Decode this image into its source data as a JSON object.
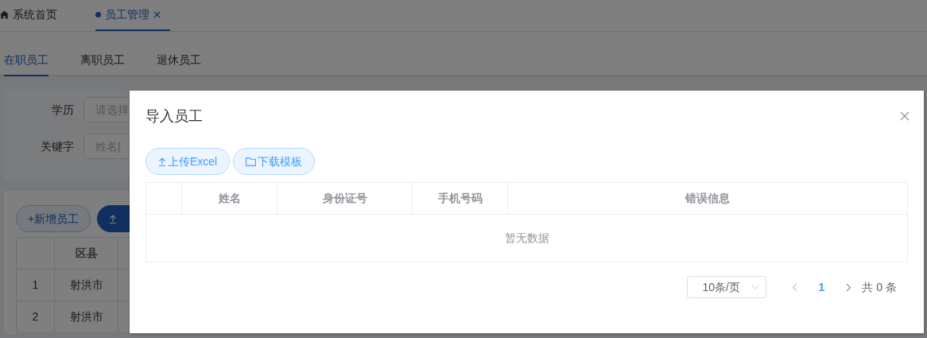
{
  "top_tabs": [
    {
      "kind": "home",
      "label": "系统首页",
      "selected": false
    },
    {
      "kind": "page",
      "label": "员工管理",
      "selected": true
    }
  ],
  "sub_tabs": [
    {
      "label": "在职员工",
      "selected": true
    },
    {
      "label": "离职员工",
      "selected": false
    },
    {
      "label": "退休员工",
      "selected": false
    }
  ],
  "filters": [
    {
      "label": "学历",
      "placeholder": "请选择"
    },
    {
      "label": "关键字",
      "placeholder": "姓名|"
    }
  ],
  "actions": [
    {
      "kind": "outline",
      "label": "+新增员工"
    },
    {
      "kind": "primary"
    }
  ],
  "table": {
    "columns": [
      "区县"
    ],
    "rows": [
      {
        "index": "1",
        "cells": [
          "射洪市"
        ]
      },
      {
        "index": "2",
        "cells": [
          "射洪市"
        ]
      }
    ]
  },
  "dialog": {
    "title": "导入员工",
    "buttons": [
      {
        "kind": "upload",
        "label": "上传Excel"
      },
      {
        "kind": "download",
        "label": "下载模板"
      }
    ],
    "table": {
      "columns": [
        "姓名",
        "身份证号",
        "手机号码",
        "错误信息"
      ],
      "empty_text": "暂无数据"
    },
    "pagination": {
      "page_size": "10条/页",
      "pages": [
        {
          "label": "1",
          "selected": true
        }
      ],
      "total": "共 0 条"
    }
  }
}
